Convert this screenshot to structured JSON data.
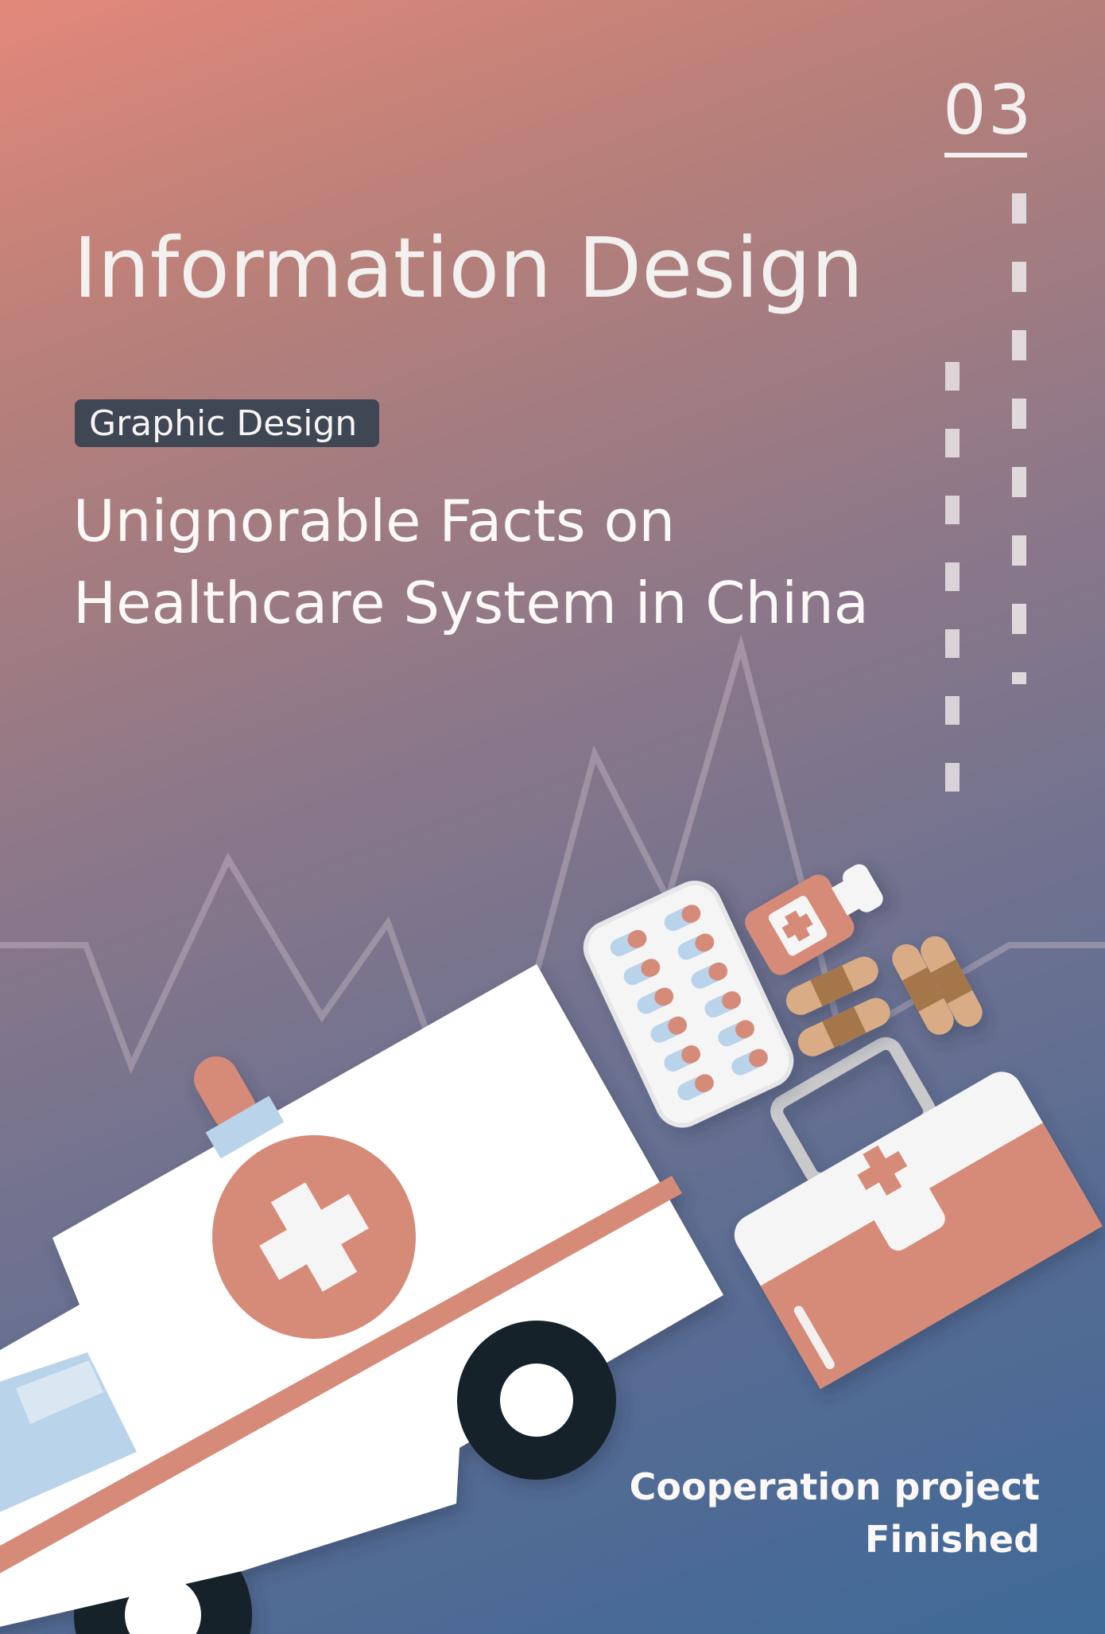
{
  "page_number": "03",
  "title": "Information Design",
  "tag": "Graphic Design",
  "subtitle_line1": "Unignorable Facts on",
  "subtitle_line2": "Healthcare System in China",
  "footer": {
    "line1": "Cooperation project",
    "line2": "Finished"
  },
  "colors": {
    "accent": "#d68a78",
    "light": "#f3f0f0",
    "tag_bg": "#3f4654",
    "wheel": "#16202b",
    "glass": "#b9d3ea"
  },
  "illustration": {
    "items": [
      "ambulance",
      "medicine-box",
      "pill-blister",
      "medicine-bottle",
      "bandages",
      "heartbeat-line"
    ]
  }
}
